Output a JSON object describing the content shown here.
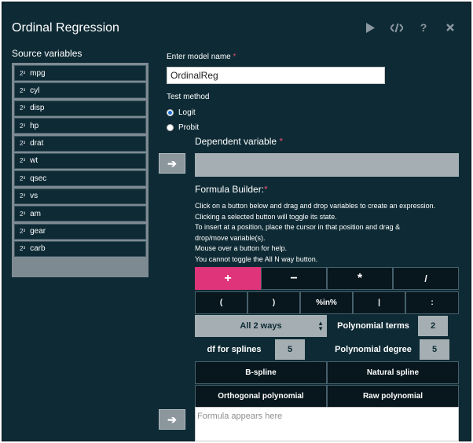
{
  "window": {
    "title": "Ordinal Regression"
  },
  "header_icons": [
    "run-icon",
    "code-icon",
    "help-icon",
    "close-icon"
  ],
  "source": {
    "label": "Source variables",
    "type_icon": "2³",
    "variables": [
      "mpg",
      "cyl",
      "disp",
      "hp",
      "drat",
      "wt",
      "qsec",
      "vs",
      "am",
      "gear",
      "carb"
    ]
  },
  "model": {
    "label": "Enter model name",
    "required": "*",
    "value": "OrdinalReg"
  },
  "test_method": {
    "label": "Test method",
    "options": [
      "Logit",
      "Probit"
    ],
    "selected": "Logit"
  },
  "dependent": {
    "label": "Dependent variable",
    "required": "*",
    "value": ""
  },
  "formula_builder": {
    "label": "Formula Builder:",
    "required": "*",
    "help_lines": [
      "Click on a button below and drag and drop variables to create an expression.",
      "Clicking a selected button will toggle its state.",
      "To insert at a position, place the cursor in that position and drag &",
      "drop/move variable(s).",
      "Mouse over a button for help.",
      "You cannot toggle the All N way button."
    ],
    "operators_row1": [
      "+",
      "−",
      "*",
      "/"
    ],
    "operators_row2": [
      "(",
      ")",
      "%in%",
      "|",
      ":"
    ],
    "ways_select": "All 2 ways",
    "polynomial_terms_label": "Polynomial terms",
    "polynomial_terms_value": "2",
    "df_splines_label": "df for splines",
    "df_splines_value": "5",
    "polynomial_degree_label": "Polynomial degree",
    "polynomial_degree_value": "5",
    "bspline_label": "B-spline",
    "natural_spline_label": "Natural spline",
    "orthogonal_label": "Orthogonal polynomial",
    "raw_label": "Raw polynomial",
    "formula_placeholder": "Formula appears here"
  },
  "arrow_glyph": "➔"
}
